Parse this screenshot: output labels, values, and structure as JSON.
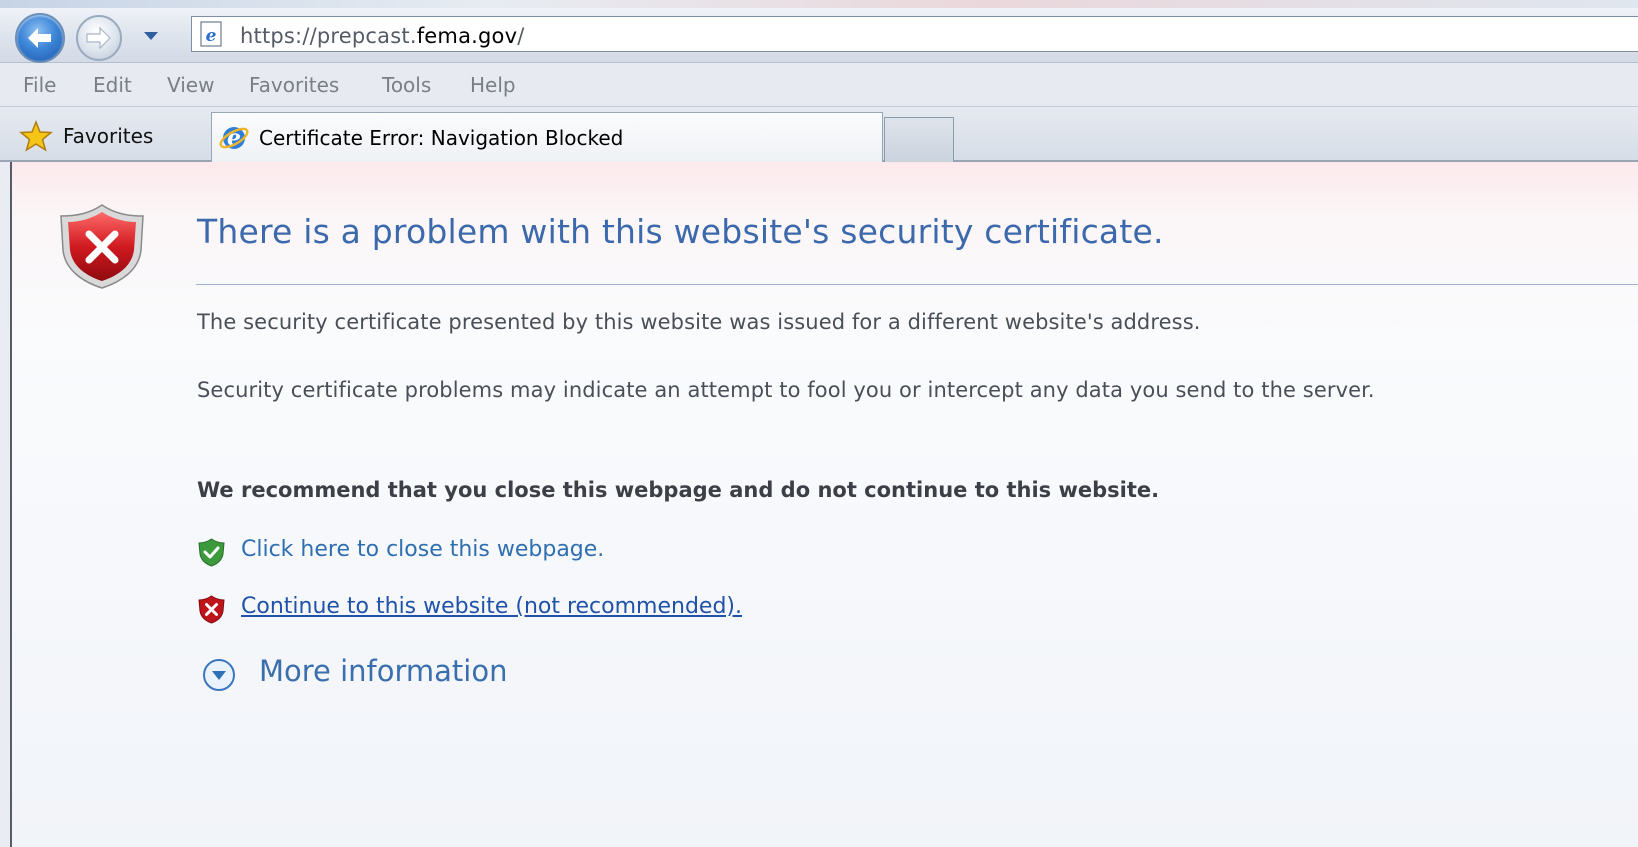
{
  "browser": {
    "address": {
      "prefix": "https://prepcast.",
      "host": "fema.gov",
      "suffix": "/"
    },
    "menu": [
      "File",
      "Edit",
      "View",
      "Favorites",
      "Tools",
      "Help"
    ],
    "favorites_label": "Favorites",
    "tab_title": "Certificate Error: Navigation Blocked"
  },
  "page": {
    "headline": "There is a problem with this website's security certificate.",
    "paragraph_1": "The security certificate presented by this website was issued for a different website's address.",
    "paragraph_2": "Security certificate problems may indicate an attempt to fool you or intercept any data you send to the server.",
    "recommendation": "We recommend that you close this webpage and do not continue to this website.",
    "close_link": "Click here to close this webpage.",
    "continue_link": "Continue to this website (not recommended).",
    "more_info": "More information"
  },
  "colors": {
    "headline": "#3c69ab",
    "link": "#2f6fb0",
    "shield_red": "#c0141b",
    "shield_green": "#3c9a3c"
  },
  "icons": {
    "back": "back-arrow-icon",
    "forward": "forward-arrow-icon",
    "page": "ie-page-icon",
    "favorites": "star-icon",
    "tab": "ie-logo-icon",
    "error": "red-shield-x-icon",
    "safe": "green-shield-check-icon",
    "unsafe": "red-shield-x-icon",
    "expand": "chevron-down-circle-icon"
  }
}
